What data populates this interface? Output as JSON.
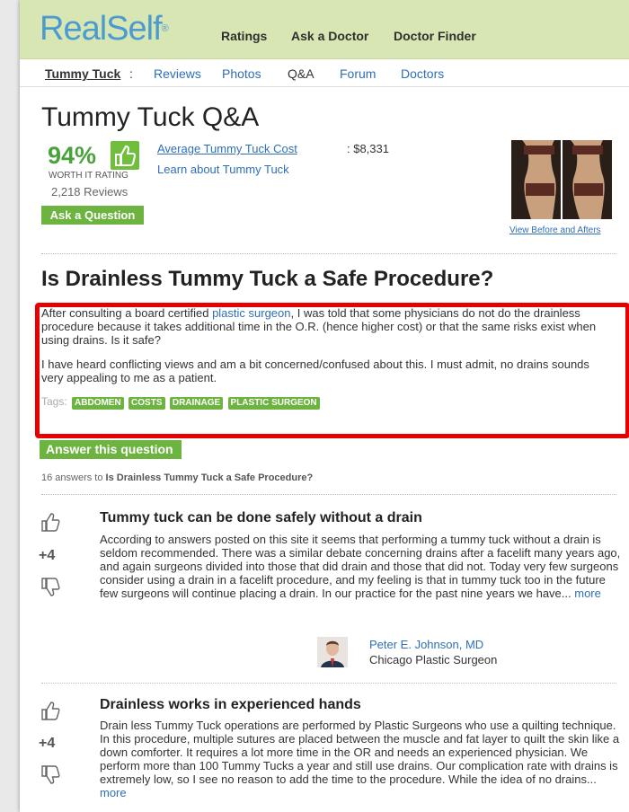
{
  "header": {
    "logo": "RealSelf",
    "logo_mark": "®",
    "nav": [
      "Ratings",
      "Ask a Doctor",
      "Doctor Finder"
    ]
  },
  "subnav": {
    "topic": "Tummy Tuck",
    "separator": ":",
    "items": [
      "Reviews",
      "Photos",
      "Q&A",
      "Forum",
      "Doctors"
    ],
    "active": "Q&A"
  },
  "page_title": "Tummy Tuck Q&A",
  "rating": {
    "percent": "94%",
    "label": "WORTH IT RATING",
    "reviews": "2,218 Reviews",
    "ask_button": "Ask a Question"
  },
  "info": {
    "avg_cost_label": "Average Tummy Tuck Cost",
    "avg_cost_value": ": $8,331",
    "learn_link": "Learn about Tummy Tuck",
    "view_before_after": "View Before and Afters"
  },
  "question": {
    "title": "Is Drainless Tummy Tuck a Safe Procedure?",
    "body1_pre": "After consulting a board certified ",
    "body1_link": "plastic surgeon",
    "body1_post": ", I was told that some physicians do not do the drainless procedure because it takes additional time in the O.R. (hence higher cost) or that the same risks exist when using drains. Is it safe?",
    "body2": "I have heard conflicting views and am a bit concerned/confused about this. I must admit, no drains sounds very appealing to me as a patient.",
    "tags_label": "Tags:",
    "tags": [
      "ABDOMEN",
      "COSTS",
      "DRAINAGE",
      "PLASTIC SURGEON"
    ]
  },
  "answer_button": "Answer this question",
  "answers_count_pre": "16 answers to ",
  "answers_count_q": "Is Drainless Tummy Tuck a Safe Procedure?",
  "answers": [
    {
      "votes": "+4",
      "title": "Tummy tuck can be done safely without a drain",
      "body": "According to answers posted on this site it seems that performing a tummy tuck without a drain is seldom recommended. There was a similar debate concerning drains after a facelift many years ago, and again surgeons divided into those that did drain and those that did not. Today very few surgeons consider using a drain in a facelift procedure, and my feeling is that in tummy tuck too in the future few surgeons will continue placing a drain. In our practice for the past nine years we have...",
      "more": "more",
      "doctor": "Peter E. Johnson, MD",
      "location": "Chicago Plastic Surgeon"
    },
    {
      "votes": "+4",
      "title": "Drainless works in experienced hands",
      "body": "Drain less Tummy Tuck operations are performed by Plastic Surgeons who use a quilting technique. In this procedure, multiple sutures are placed between the muscle and fat layer to quilt the skin like a down comforter. It requires a lot more time in the OR and needs an experienced physician. We perform more than 100 Tummy Tucks a year and still use drains. Our complication rate with drains is extremely low, so I see no reason to add the time to the procedure. While the idea of no drains...",
      "more": "more"
    }
  ]
}
